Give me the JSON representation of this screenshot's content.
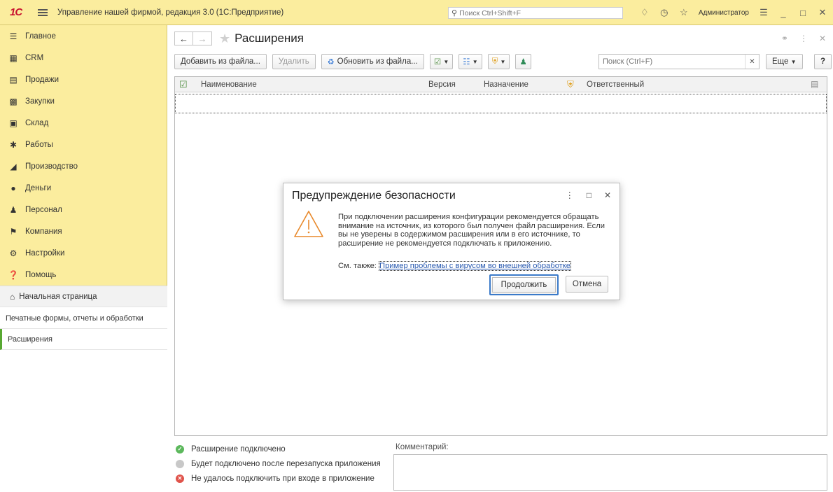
{
  "app": {
    "title": "Управление нашей фирмой, редакция 3.0  (1С:Предприятие)",
    "search_placeholder": "Поиск Ctrl+Shift+F",
    "user": "Администратор"
  },
  "sidebar": {
    "items": [
      {
        "label": "Главное",
        "icon": "menu-icon"
      },
      {
        "label": "CRM",
        "icon": "crm-icon"
      },
      {
        "label": "Продажи",
        "icon": "cart-icon"
      },
      {
        "label": "Закупки",
        "icon": "purchases-icon"
      },
      {
        "label": "Склад",
        "icon": "warehouse-icon"
      },
      {
        "label": "Работы",
        "icon": "tools-icon"
      },
      {
        "label": "Производство",
        "icon": "factory-icon"
      },
      {
        "label": "Деньги",
        "icon": "money-icon"
      },
      {
        "label": "Персонал",
        "icon": "people-icon"
      },
      {
        "label": "Компания",
        "icon": "flag-icon"
      },
      {
        "label": "Настройки",
        "icon": "gear-icon"
      },
      {
        "label": "Помощь",
        "icon": "help-icon"
      }
    ],
    "home": "Начальная страница",
    "sub_items": [
      "Печатные формы, отчеты и обработки",
      "Расширения"
    ]
  },
  "page": {
    "title": "Расширения",
    "toolbar": {
      "add_from_file": "Добавить из файла...",
      "delete": "Удалить",
      "update_from_file": "Обновить из файла...",
      "search_placeholder": "Поиск (Ctrl+F)",
      "more": "Еще",
      "help": "?"
    },
    "columns": [
      "Наименование",
      "Версия",
      "Назначение",
      "Ответственный"
    ]
  },
  "legend": [
    {
      "label": "Расширение подключено",
      "color": "#5cb85c"
    },
    {
      "label": "Будет подключено после перезапуска приложения",
      "color": "#c8c8c8"
    },
    {
      "label": "Не удалось подключить при входе в приложение",
      "color": "#e0534b"
    }
  ],
  "comment_label": "Комментарий:",
  "dialog": {
    "title": "Предупреждение безопасности",
    "text": "При подключении расширения конфигурации рекомендуется обращать внимание на источник, из которого был получен файл расширения. Если вы не уверены в содержимом расширения или в его источнике, то расширение не рекомендуется подключать к приложению.",
    "see_also_label": "См. также:",
    "see_also_link": "Пример проблемы с вирусом во внешней обработке",
    "continue": "Продолжить",
    "cancel": "Отмена",
    "warning_color": "#e8892b"
  }
}
